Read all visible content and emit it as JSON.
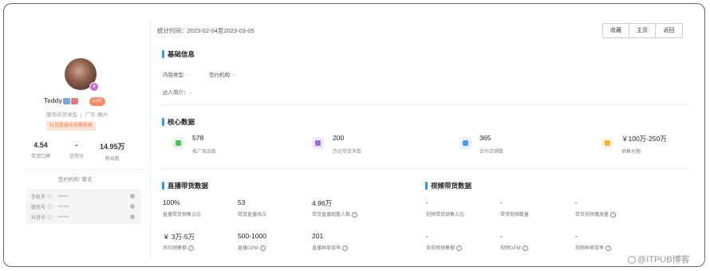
{
  "profile": {
    "name": "Teddy",
    "level": "LV0",
    "type_label": "服饰带货类型",
    "region": "广东·惠州",
    "warning": "抖音数据未采集数据",
    "stats": [
      {
        "value": "4.54",
        "label": "带货口碑"
      },
      {
        "value": "-",
        "label": "信用分"
      },
      {
        "value": "14.95万",
        "label": "粉丝数"
      }
    ],
    "org_label": "签约机构:",
    "org_value": "暂无",
    "contacts": [
      {
        "label": "手机号 ⓘ:",
        "value": "******"
      },
      {
        "label": "微信号 ⓘ:",
        "value": "******"
      },
      {
        "label": "抖音号 ⓘ:",
        "value": "******"
      }
    ]
  },
  "header": {
    "date_range": "统计时间：2023-02-04至2023-03-05",
    "buttons": [
      "收藏",
      "主页",
      "返回"
    ]
  },
  "basic": {
    "title": "基础信息",
    "content_type": "内容类型: -",
    "sign_org": "签约机构: -",
    "intro": "达人简介：  -"
  },
  "core": {
    "title": "核心数据",
    "items": [
      {
        "value": "578",
        "label": "推广商品数",
        "color": "#e8f7e8",
        "accent": "#4cbf5a"
      },
      {
        "value": "200",
        "label": "历史带货天数",
        "color": "#efe8fb",
        "accent": "#9a6ee0"
      },
      {
        "value": "365",
        "label": "合作店铺数",
        "color": "#e6f1fc",
        "accent": "#4a9be8"
      },
      {
        "value": "￥100万-250万",
        "label": "销售总额",
        "color": "#fdf3e3",
        "accent": "#f2b23a"
      }
    ]
  },
  "live": {
    "title": "直播带货数据",
    "row1": [
      {
        "value": "100%",
        "label": "直播带货销售占比",
        "help": false
      },
      {
        "value": "53",
        "label": "带货直播场次",
        "help": false
      },
      {
        "value": "4.96万",
        "label": "带货直播观看人数",
        "help": true
      }
    ],
    "row2": [
      {
        "value": "￥ 3万-5万",
        "label": "场均销售额",
        "help": true
      },
      {
        "value": "500-1000",
        "label": "直播GPM",
        "help": true
      },
      {
        "value": "201",
        "label": "直播种草效率",
        "help": true
      }
    ]
  },
  "video": {
    "title": "视频带货数据",
    "row1": [
      {
        "value": "-",
        "label": "视频带货销售占比",
        "help": false
      },
      {
        "value": "-",
        "label": "带货视频数量",
        "help": false
      },
      {
        "value": "-",
        "label": "带货视频播放量",
        "help": true
      }
    ],
    "row2": [
      {
        "value": "-",
        "label": "单视频销售额",
        "help": true
      },
      {
        "value": "-",
        "label": "视频GPM",
        "help": true
      },
      {
        "value": "-",
        "label": "视频种草效率",
        "help": true
      }
    ]
  },
  "watermark": "@ITPUB博客"
}
